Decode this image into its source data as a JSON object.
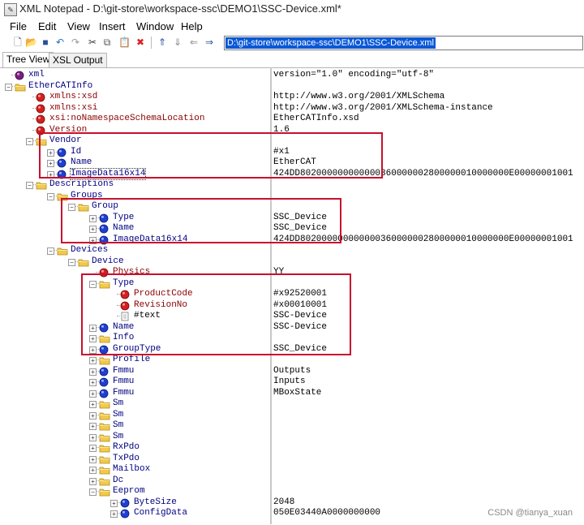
{
  "window": {
    "title": "XML Notepad - D:\\git-store\\workspace-ssc\\DEMO1\\SSC-Device.xml*"
  },
  "menu": [
    "File",
    "Edit",
    "View",
    "Insert",
    "Window",
    "Help"
  ],
  "toolbar": {
    "icons": [
      "new-file-icon",
      "open-folder-icon",
      "save-icon",
      "undo-icon",
      "redo-icon",
      "cut-icon",
      "copy-icon",
      "paste-icon",
      "delete-icon",
      "nudge-up-icon",
      "nudge-down-icon",
      "nudge-left-icon",
      "nudge-right-icon"
    ],
    "location": "D:\\git-store\\workspace-ssc\\DEMO1\\SSC-Device.xml"
  },
  "tabs": [
    "Tree View",
    "XSL Output"
  ],
  "tree": [
    {
      "depth": 0,
      "type": "pi",
      "name": "xml",
      "value": "version=\"1.0\" encoding=\"utf-8\"",
      "exp": ""
    },
    {
      "depth": 0,
      "type": "folder",
      "name": "EtherCATInfo",
      "value": "",
      "exp": "-"
    },
    {
      "depth": 1,
      "type": "attr",
      "name": "xmlns:xsd",
      "value": "http://www.w3.org/2001/XMLSchema",
      "exp": ""
    },
    {
      "depth": 1,
      "type": "attr",
      "name": "xmlns:xsi",
      "value": "http://www.w3.org/2001/XMLSchema-instance",
      "exp": ""
    },
    {
      "depth": 1,
      "type": "attr",
      "name": "xsi:noNamespaceSchemaLocation",
      "value": "EtherCATInfo.xsd",
      "exp": ""
    },
    {
      "depth": 1,
      "type": "attr",
      "name": "Version",
      "value": "1.6",
      "exp": ""
    },
    {
      "depth": 1,
      "type": "folder",
      "name": "Vendor",
      "value": "",
      "exp": "-"
    },
    {
      "depth": 2,
      "type": "elem",
      "name": "Id",
      "value": "#x1",
      "exp": "+"
    },
    {
      "depth": 2,
      "type": "elem",
      "name": "Name",
      "value": "EtherCAT",
      "exp": "+"
    },
    {
      "depth": 2,
      "type": "elem",
      "name": "ImageData16x14",
      "value": "424DD802000000000000360000002800000010000000E00000001001",
      "exp": "+",
      "sel": true
    },
    {
      "depth": 1,
      "type": "folder",
      "name": "Descriptions",
      "value": "",
      "exp": "-"
    },
    {
      "depth": 2,
      "type": "folder",
      "name": "Groups",
      "value": "",
      "exp": "-"
    },
    {
      "depth": 3,
      "type": "folder",
      "name": "Group",
      "value": "",
      "exp": "-"
    },
    {
      "depth": 4,
      "type": "elem",
      "name": "Type",
      "value": "SSC_Device",
      "exp": "+"
    },
    {
      "depth": 4,
      "type": "elem",
      "name": "Name",
      "value": "SSC_Device",
      "exp": "+"
    },
    {
      "depth": 4,
      "type": "elem",
      "name": "ImageData16x14",
      "value": "424DD802000000000000360000002800000010000000E00000001001",
      "exp": "+"
    },
    {
      "depth": 2,
      "type": "folder",
      "name": "Devices",
      "value": "",
      "exp": "-"
    },
    {
      "depth": 3,
      "type": "folder",
      "name": "Device",
      "value": "",
      "exp": "-"
    },
    {
      "depth": 4,
      "type": "attr",
      "name": "Physics",
      "value": "YY",
      "exp": ""
    },
    {
      "depth": 4,
      "type": "folder",
      "name": "Type",
      "value": "",
      "exp": "-"
    },
    {
      "depth": 5,
      "type": "attr",
      "name": "ProductCode",
      "value": "#x92520001",
      "exp": ""
    },
    {
      "depth": 5,
      "type": "attr",
      "name": "RevisionNo",
      "value": "#x00010001",
      "exp": ""
    },
    {
      "depth": 5,
      "type": "text",
      "name": "#text",
      "value": "SSC-Device",
      "exp": ""
    },
    {
      "depth": 4,
      "type": "elem",
      "name": "Name",
      "value": "SSC-Device",
      "exp": "+"
    },
    {
      "depth": 4,
      "type": "folder",
      "name": "Info",
      "value": "",
      "exp": "+"
    },
    {
      "depth": 4,
      "type": "elem",
      "name": "GroupType",
      "value": "SSC_Device",
      "exp": "+"
    },
    {
      "depth": 4,
      "type": "folder",
      "name": "Profile",
      "value": "",
      "exp": "+"
    },
    {
      "depth": 4,
      "type": "elem",
      "name": "Fmmu",
      "value": "Outputs",
      "exp": "+"
    },
    {
      "depth": 4,
      "type": "elem",
      "name": "Fmmu",
      "value": "Inputs",
      "exp": "+"
    },
    {
      "depth": 4,
      "type": "elem",
      "name": "Fmmu",
      "value": "MBoxState",
      "exp": "+"
    },
    {
      "depth": 4,
      "type": "folder",
      "name": "Sm",
      "value": "",
      "exp": "+"
    },
    {
      "depth": 4,
      "type": "folder",
      "name": "Sm",
      "value": "",
      "exp": "+"
    },
    {
      "depth": 4,
      "type": "folder",
      "name": "Sm",
      "value": "",
      "exp": "+"
    },
    {
      "depth": 4,
      "type": "folder",
      "name": "Sm",
      "value": "",
      "exp": "+"
    },
    {
      "depth": 4,
      "type": "folder",
      "name": "RxPdo",
      "value": "",
      "exp": "+"
    },
    {
      "depth": 4,
      "type": "folder",
      "name": "TxPdo",
      "value": "",
      "exp": "+"
    },
    {
      "depth": 4,
      "type": "folder",
      "name": "Mailbox",
      "value": "",
      "exp": "+"
    },
    {
      "depth": 4,
      "type": "folder",
      "name": "Dc",
      "value": "",
      "exp": "+"
    },
    {
      "depth": 4,
      "type": "folder",
      "name": "Eeprom",
      "value": "",
      "exp": "-"
    },
    {
      "depth": 5,
      "type": "elem",
      "name": "ByteSize",
      "value": "2048",
      "exp": "+"
    },
    {
      "depth": 5,
      "type": "elem",
      "name": "ConfigData",
      "value": "050E03440A0000000000",
      "exp": "+"
    }
  ],
  "watermark": "CSDN @tianya_xuan",
  "colors": {
    "highlight": "#c8102e",
    "selection": "#0a58d6",
    "attr_text": "#8b0000",
    "elem_text": "#000080"
  }
}
